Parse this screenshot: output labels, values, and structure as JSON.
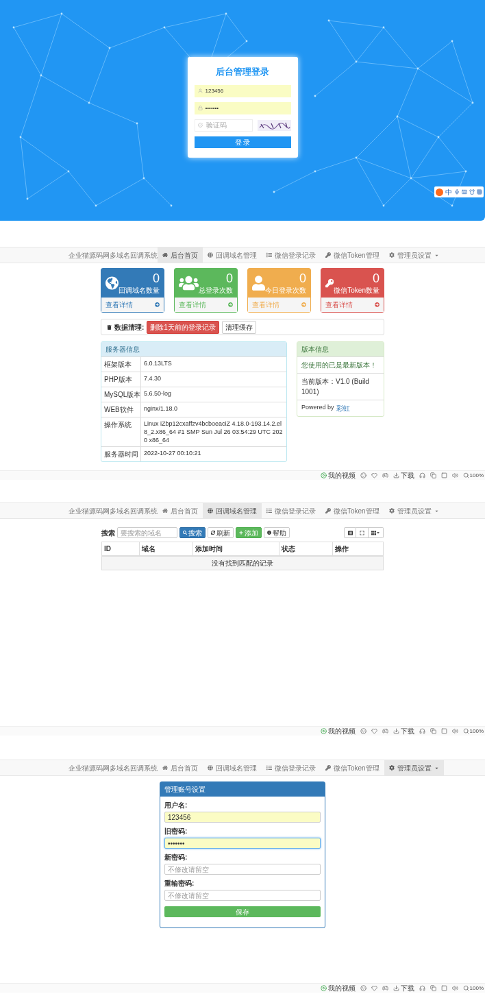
{
  "login": {
    "title": "后台管理登录",
    "username": {
      "value": "123456"
    },
    "password": {
      "value": "•••••••"
    },
    "captcha": {
      "placeholder": "验证码"
    },
    "submit": "登 录"
  },
  "ime_toolbar": {
    "mode": "中"
  },
  "dashboard_screen": {
    "navbar": {
      "brand": "企业猫源码网多域名回调系统",
      "items": [
        {
          "label": "后台首页",
          "selected": true,
          "dropdown": false
        },
        {
          "label": "回调域名管理",
          "selected": false,
          "dropdown": false
        },
        {
          "label": "微信登录记录",
          "selected": false,
          "dropdown": false
        },
        {
          "label": "微信Token管理",
          "selected": false,
          "dropdown": false
        },
        {
          "label": "管理员设置",
          "selected": false,
          "dropdown": true
        }
      ]
    },
    "stat_cards": [
      {
        "count": "0",
        "label": "回调域名数量",
        "link": "查看详情",
        "color": "#337ab7"
      },
      {
        "count": "0",
        "label": "总登录次数",
        "link": "查看详情",
        "color": "#5cb85c"
      },
      {
        "count": "0",
        "label": "今日登录次数",
        "link": "查看详情",
        "color": "#f0ad4e"
      },
      {
        "count": "0",
        "label": "微信Token数量",
        "link": "查看详情",
        "color": "#d9534f"
      }
    ],
    "data_cleanup": {
      "label": "数据清理:",
      "buttons": [
        {
          "label": "删除1天前的登录记录",
          "kind": "danger"
        },
        {
          "label": "清理缓存",
          "kind": "default"
        }
      ]
    },
    "server_info": {
      "title": "服务器信息",
      "rows": [
        {
          "label": "框架版本",
          "value": "6.0.13LTS"
        },
        {
          "label": "PHP版本",
          "value": "7.4.30"
        },
        {
          "label": "MySQL版本",
          "value": "5.6.50-log"
        },
        {
          "label": "WEB软件",
          "value": "nginx/1.18.0"
        },
        {
          "label": "操作系统",
          "value": "Linux iZbp12cxaffzv4bcboeaciZ 4.18.0-193.14.2.el8_2.x86_64 #1 SMP Sun Jul 26 03:54:29 UTC 2020 x86_64"
        },
        {
          "label": "服务器时间",
          "value": "2022-10-27 00:10:21"
        }
      ]
    },
    "version_info": {
      "title": "版本信息",
      "status": "您使用的已是最新版本！",
      "version": "当前版本：V1.0 (Build 1001)",
      "powered_by": "Powered by",
      "author": "彩虹"
    },
    "status_bar": {
      "video": "我的视频",
      "download": "下载",
      "zoom": "100%"
    }
  },
  "domain_list_screen": {
    "navbar": {
      "brand": "企业猫源码网多域名回调系统",
      "items": [
        {
          "label": "后台首页",
          "selected": false,
          "dropdown": false
        },
        {
          "label": "回调域名管理",
          "selected": true,
          "dropdown": false
        },
        {
          "label": "微信登录记录",
          "selected": false,
          "dropdown": false
        },
        {
          "label": "微信Token管理",
          "selected": false,
          "dropdown": false
        },
        {
          "label": "管理员设置",
          "selected": false,
          "dropdown": true
        }
      ]
    },
    "search": {
      "label": "搜索",
      "placeholder": "要搜索的域名"
    },
    "buttons": [
      {
        "label": "搜索",
        "kind": "primary"
      },
      {
        "label": "刷新",
        "kind": "default"
      },
      {
        "label": "添加",
        "kind": "success"
      },
      {
        "label": "帮助",
        "kind": "default"
      }
    ],
    "table": {
      "columns": [
        "ID",
        "域名",
        "添加时间",
        "状态",
        "操作"
      ],
      "empty_message": "没有找到匹配的记录"
    },
    "status_bar": {
      "video": "我的视频",
      "download": "下载",
      "zoom": "100%"
    }
  },
  "account_screen": {
    "navbar": {
      "brand": "企业猫源码网多域名回调系统",
      "items": [
        {
          "label": "后台首页",
          "selected": false,
          "dropdown": false
        },
        {
          "label": "回调域名管理",
          "selected": false,
          "dropdown": false
        },
        {
          "label": "微信登录记录",
          "selected": false,
          "dropdown": false
        },
        {
          "label": "微信Token管理",
          "selected": false,
          "dropdown": false
        },
        {
          "label": "管理员设置",
          "selected": true,
          "dropdown": true
        }
      ]
    },
    "panel": {
      "title": "管理账号设置",
      "fields": [
        {
          "label": "用户名:",
          "value": "123456",
          "focused": false
        },
        {
          "label": "旧密码:",
          "value": "•••••••",
          "focused": true
        },
        {
          "label": "新密码:",
          "placeholder": "不修改请留空",
          "focused": false
        },
        {
          "label": "重输密码:",
          "placeholder": "不修改请留空",
          "focused": false
        }
      ],
      "save": "保存"
    },
    "status_bar": {
      "video": "我的视频",
      "download": "下载",
      "zoom": "100%"
    }
  }
}
